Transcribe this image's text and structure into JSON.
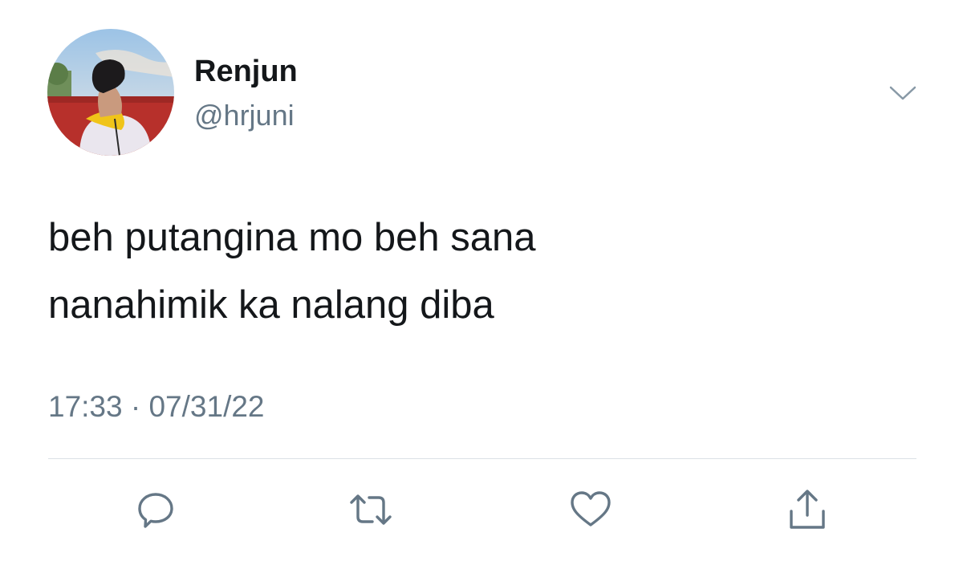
{
  "author": {
    "display_name": "Renjun",
    "handle": "@hrjuni"
  },
  "tweet": {
    "lines": [
      "beh putangina mo beh sana",
      "nanahimik ka nalang diba"
    ],
    "time": "17:33",
    "separator": "·",
    "date": "07/31/22"
  },
  "icons": {
    "menu": "chevron-down-icon",
    "reply": "speech-bubble-icon",
    "retweet": "retweet-arrows-icon",
    "like": "heart-icon",
    "share": "share-arrow-up-icon"
  },
  "colors": {
    "text": "#14171a",
    "secondary": "#657786",
    "divider": "#dbe1e6",
    "icon": "#657786"
  }
}
